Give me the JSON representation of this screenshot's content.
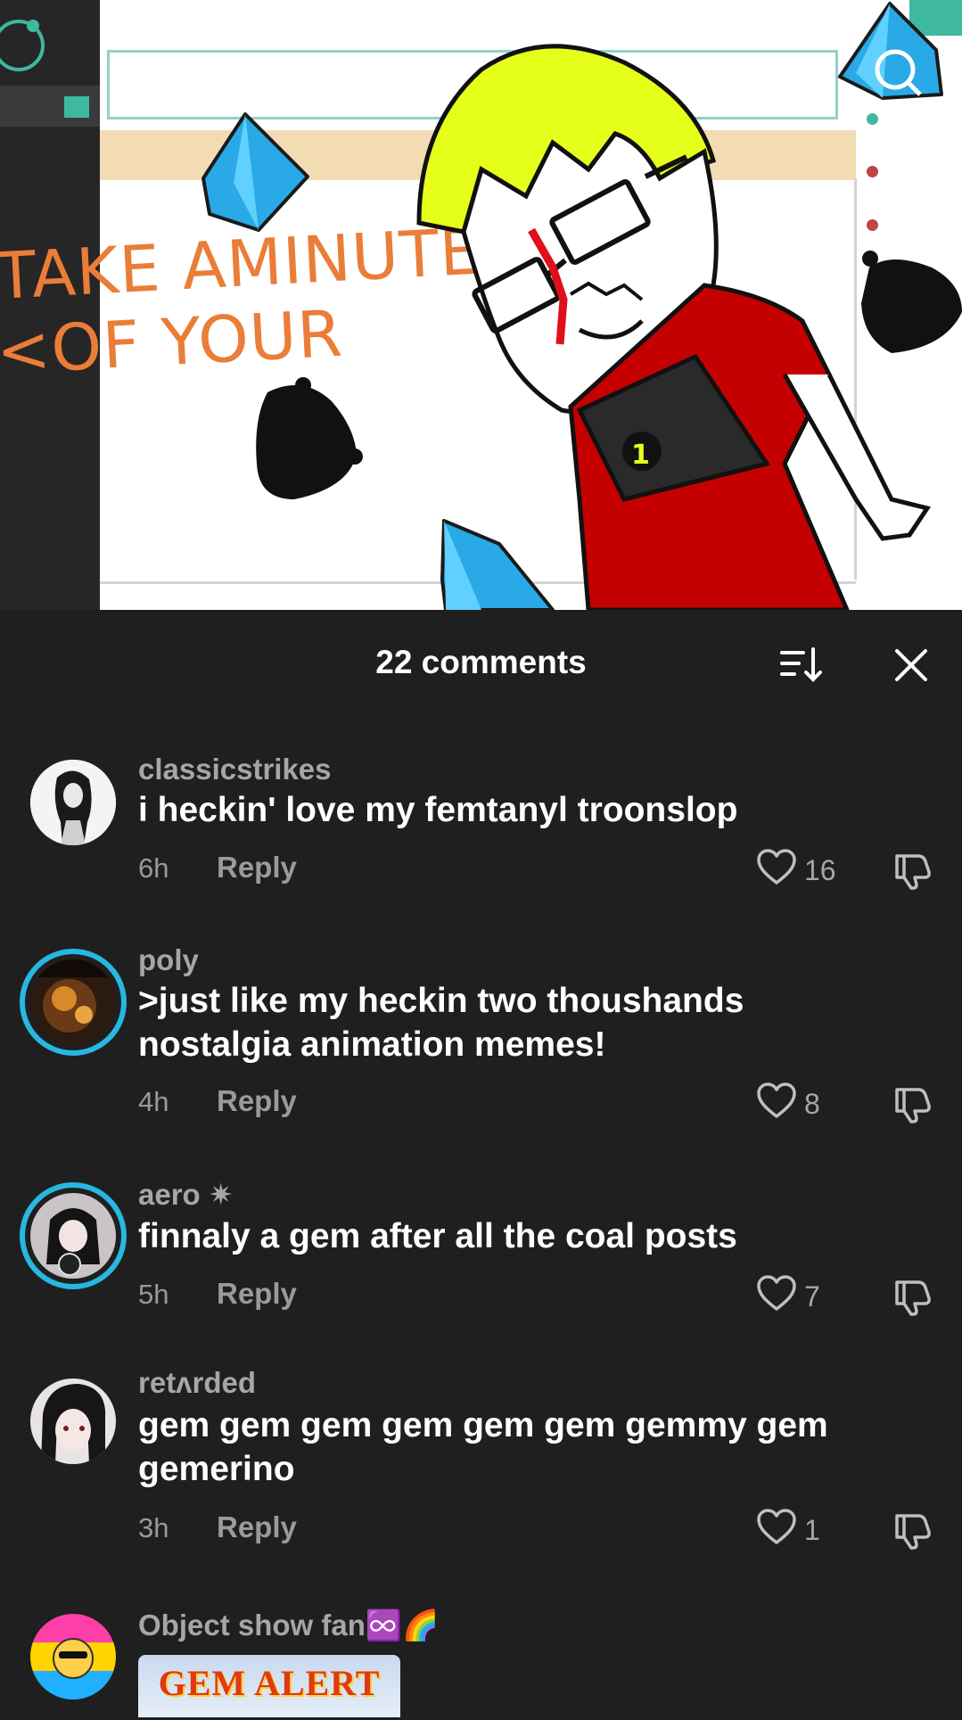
{
  "video": {
    "overlay_line1": "TAKE AMINUTE",
    "overlay_line2": "<OF YOUR",
    "shirt_number": "1",
    "accent_color": "#3fb8a0",
    "text_color": "#ea7d38"
  },
  "comments_sheet": {
    "title": "22 comments",
    "sort_icon": "sort-down-icon",
    "close_icon": "close-icon",
    "comments": [
      {
        "username": "classicstrikes",
        "text": "i heckin' love my femtanyl troonslop",
        "time": "6h",
        "reply_label": "Reply",
        "likes": "16"
      },
      {
        "username": "poly",
        "text": ">just like my heckin two thoushands nostalgia animation memes!",
        "time": "4h",
        "reply_label": "Reply",
        "likes": "8"
      },
      {
        "username": "aero",
        "username_badge": "✷",
        "text": "finnaly a gem after all the coal posts",
        "time": "5h",
        "reply_label": "Reply",
        "likes": "7"
      },
      {
        "username": "retʌrded",
        "text": "gem gem gem gem gem gem gemmy gem gemerino",
        "time": "3h",
        "reply_label": "Reply",
        "likes": "1"
      },
      {
        "username": "Object show fan♾️🌈",
        "image_text": "GEM ALERT"
      }
    ]
  }
}
